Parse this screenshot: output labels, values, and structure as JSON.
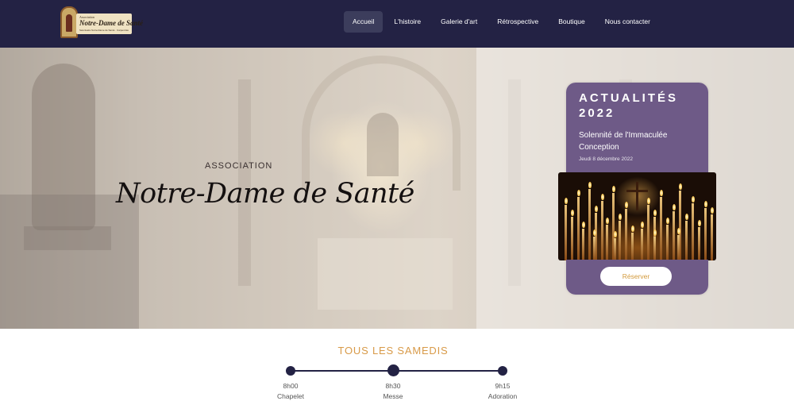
{
  "header": {
    "logo": {
      "small": "Association",
      "name": "Notre-Dame de Santé",
      "sub": "Sanctuaire Notre-Dame de Santé · Carpentras"
    },
    "nav": [
      {
        "label": "Accueil",
        "active": true
      },
      {
        "label": "L'histoire",
        "active": false
      },
      {
        "label": "Galerie d'art",
        "active": false
      },
      {
        "label": "Rétrospective",
        "active": false
      },
      {
        "label": "Boutique",
        "active": false
      },
      {
        "label": "Nous contacter",
        "active": false
      }
    ]
  },
  "hero": {
    "kicker": "ASSOCIATION",
    "title": "Notre-Dame de Santé"
  },
  "news": {
    "heading": "ACTUALITÉS 2022",
    "subtitle": "Solennité de l'Immaculée Conception",
    "date": "Jeudi 8 décembre 2022",
    "button": "Réserver"
  },
  "schedule": {
    "title": "TOUS LES SAMEDIS",
    "items": [
      {
        "time": "8h00",
        "label": "Chapelet"
      },
      {
        "time": "8h30",
        "label": "Messe"
      },
      {
        "time": "9h15",
        "label": "Adoration"
      }
    ]
  },
  "colors": {
    "header_bg": "#232244",
    "card_purple": "#6e5a87",
    "accent_gold": "#d89a48"
  }
}
